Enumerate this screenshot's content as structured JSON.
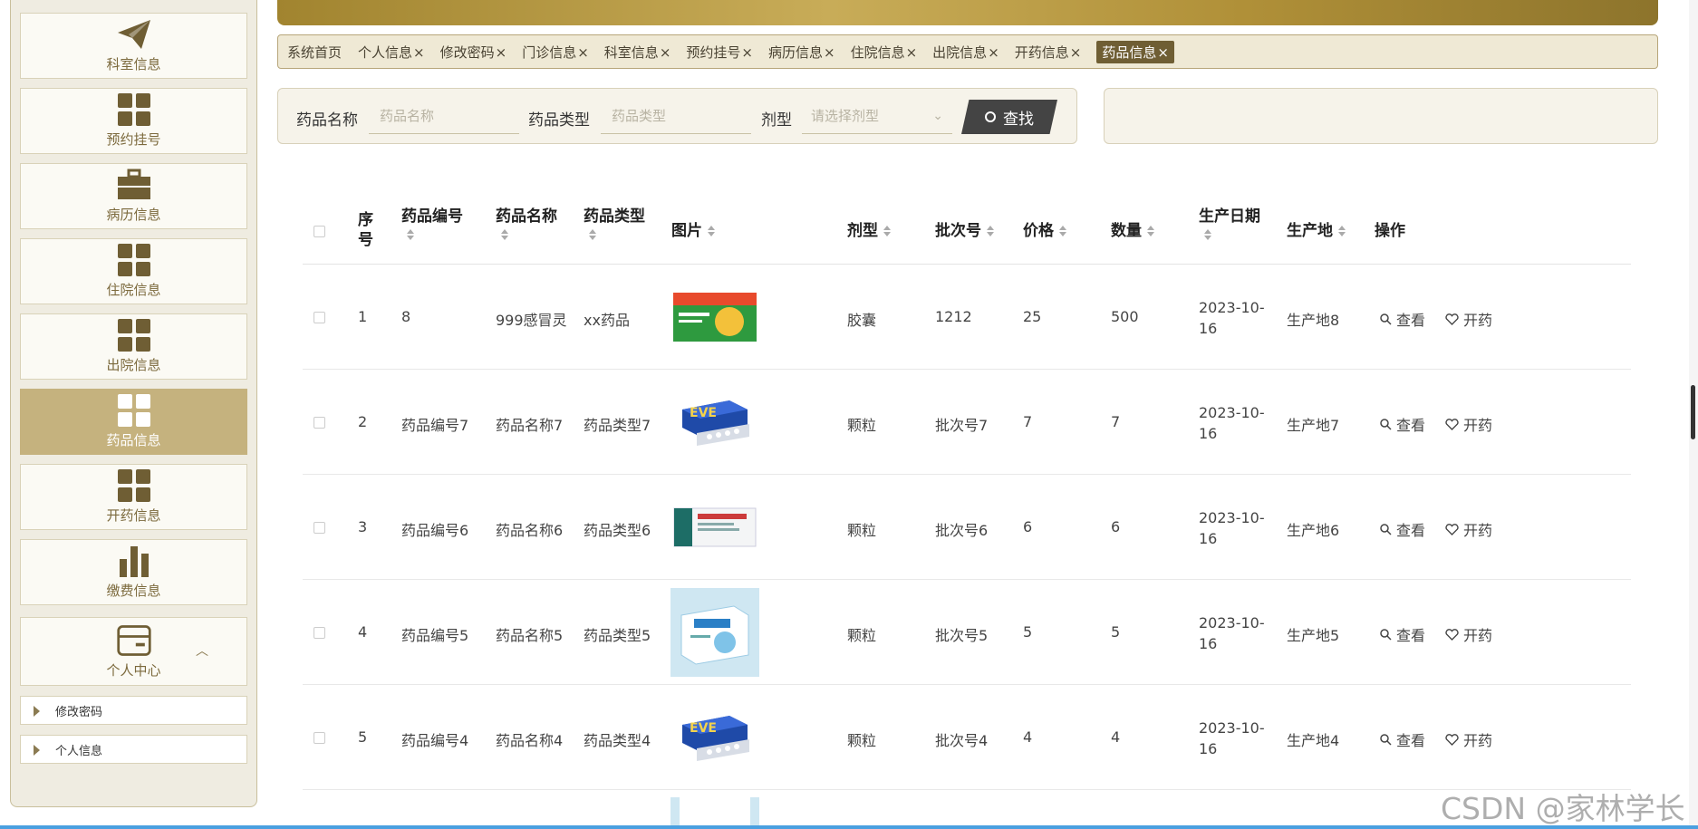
{
  "sidebar": {
    "items": [
      {
        "label": "科室信息",
        "icon": "paper-plane-icon"
      },
      {
        "label": "预约挂号",
        "icon": "grid-icon"
      },
      {
        "label": "病历信息",
        "icon": "briefcase-icon"
      },
      {
        "label": "住院信息",
        "icon": "grid-icon"
      },
      {
        "label": "出院信息",
        "icon": "grid-icon"
      },
      {
        "label": "药品信息",
        "icon": "grid-icon",
        "active": true
      },
      {
        "label": "开药信息",
        "icon": "grid-icon"
      },
      {
        "label": "缴费信息",
        "icon": "bar-chart-icon"
      },
      {
        "label": "个人中心",
        "icon": "card-icon",
        "expanded": true
      }
    ],
    "sub_items": [
      {
        "label": "修改密码"
      },
      {
        "label": "个人信息"
      }
    ]
  },
  "tabs": [
    {
      "label": "系统首页",
      "close": ""
    },
    {
      "label": "个人信息",
      "close": "×"
    },
    {
      "label": "修改密码",
      "close": "×"
    },
    {
      "label": "门诊信息",
      "close": "×"
    },
    {
      "label": "科室信息",
      "close": "×"
    },
    {
      "label": "预约挂号",
      "close": "×"
    },
    {
      "label": "病历信息",
      "close": "×"
    },
    {
      "label": "住院信息",
      "close": "×"
    },
    {
      "label": "出院信息",
      "close": "×"
    },
    {
      "label": "开药信息",
      "close": "×"
    },
    {
      "label": "药品信息",
      "close": "×",
      "active": true
    }
  ],
  "search": {
    "name_label": "药品名称",
    "name_placeholder": "药品名称",
    "type_label": "药品类型",
    "type_placeholder": "药品类型",
    "form_label": "剂型",
    "form_placeholder": "请选择剂型",
    "button_label": "查找"
  },
  "table": {
    "headers": {
      "index": "序号",
      "code": "药品编号",
      "name": "药品名称",
      "type": "药品类型",
      "image": "图片",
      "form": "剂型",
      "batch": "批次号",
      "price": "价格",
      "qty": "数量",
      "date": "生产日期",
      "origin": "生产地",
      "ops": "操作"
    },
    "rows": [
      {
        "index": "1",
        "code": "8",
        "name": "999感冒灵",
        "type": "xx药品",
        "form": "胶囊",
        "batch": "1212",
        "price": "25",
        "qty": "500",
        "date": "2023-10-16",
        "origin": "生产地8",
        "img": "green"
      },
      {
        "index": "2",
        "code": "药品编号7",
        "name": "药品名称7",
        "type": "药品类型7",
        "form": "颗粒",
        "batch": "批次号7",
        "price": "7",
        "qty": "7",
        "date": "2023-10-16",
        "origin": "生产地7",
        "img": "evf"
      },
      {
        "index": "3",
        "code": "药品编号6",
        "name": "药品名称6",
        "type": "药品类型6",
        "form": "颗粒",
        "batch": "批次号6",
        "price": "6",
        "qty": "6",
        "date": "2023-10-16",
        "origin": "生产地6",
        "img": "white"
      },
      {
        "index": "4",
        "code": "药品编号5",
        "name": "药品名称5",
        "type": "药品类型5",
        "form": "颗粒",
        "batch": "批次号5",
        "price": "5",
        "qty": "5",
        "date": "2023-10-16",
        "origin": "生产地5",
        "img": "blue"
      },
      {
        "index": "5",
        "code": "药品编号4",
        "name": "药品名称4",
        "type": "药品类型4",
        "form": "颗粒",
        "batch": "批次号4",
        "price": "4",
        "qty": "4",
        "date": "2023-10-16",
        "origin": "生产地4",
        "img": "evf"
      }
    ],
    "view_label": "查看",
    "prescribe_label": "开药"
  },
  "watermark": "CSDN @家林学长"
}
